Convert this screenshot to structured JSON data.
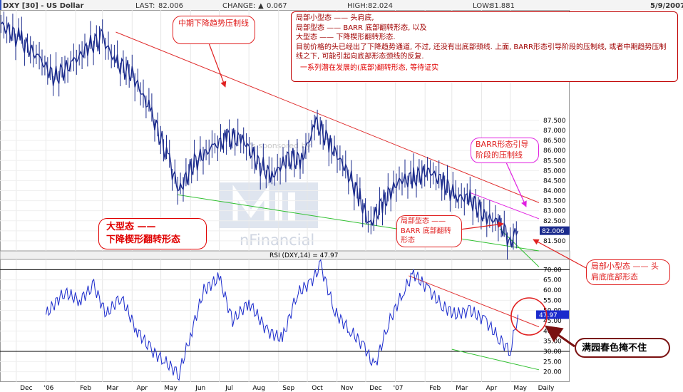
{
  "header": {
    "symbol": "DXY [30] - US Dollar",
    "last_label": "LAST:",
    "last_value": "82.006",
    "change_label": "CHANGE:",
    "change_arrow": "▲",
    "change_value": "0.067",
    "high_label": "HIGH:",
    "high_value": "82.024",
    "low_label": "LOW:",
    "low_value": "81.881",
    "date": "5/9/2007"
  },
  "watermark": {
    "partial_text": "'s sponsored by",
    "brand_fragment": "nFinancial"
  },
  "chart_data": [
    {
      "type": "line",
      "series": [
        {
          "x": [
            "2005-11-15",
            "2005-12-05",
            "2005-12-25",
            "2006-01-10",
            "2006-01-30",
            "2006-02-15",
            "2006-03-01",
            "2006-03-15",
            "2006-04-01",
            "2006-04-20",
            "2006-05-10",
            "2006-05-20",
            "2006-06-05",
            "2006-06-25",
            "2006-07-10",
            "2006-07-25",
            "2006-08-10",
            "2006-08-25",
            "2006-09-10",
            "2006-09-25",
            "2006-10-10",
            "2006-10-25",
            "2006-11-10",
            "2006-11-25",
            "2006-12-05",
            "2006-12-20",
            "2007-01-05",
            "2007-01-20",
            "2007-02-05",
            "2007-02-20",
            "2007-03-05",
            "2007-03-20",
            "2007-04-05",
            "2007-04-20",
            "2007-05-01",
            "2007-05-09"
          ],
          "values": [
            92.3,
            91.5,
            90.6,
            89.6,
            90.4,
            91.2,
            91.6,
            90.4,
            89.8,
            88.0,
            85.4,
            84.0,
            85.4,
            86.2,
            86.6,
            86.6,
            85.4,
            84.7,
            85.6,
            85.5,
            87.4,
            86.3,
            85.1,
            83.6,
            82.3,
            83.5,
            84.5,
            84.6,
            85.0,
            84.4,
            83.7,
            83.6,
            82.7,
            82.4,
            81.5,
            82.0
          ]
        }
      ],
      "y_ticks": [
        "81.500",
        "82.000",
        "82.500",
        "83.000",
        "83.500",
        "84.000",
        "84.500",
        "85.000",
        "85.500",
        "86.000",
        "86.500",
        "87.000",
        "87.500"
      ],
      "y_display_range": [
        81.0,
        93.0
      ],
      "last_value_label": "82.006",
      "trendlines": [
        {
          "name": "mid-term-downtrend",
          "color": "#e03030",
          "from": [
            "2006-03-15",
            91.9
          ],
          "to": [
            "2007-05-31",
            83.4
          ]
        },
        {
          "name": "wedge-support",
          "color": "#30c030",
          "from": [
            "2006-05-18",
            83.8
          ],
          "to": [
            "2007-05-31",
            81.0
          ]
        },
        {
          "name": "local-support",
          "color": "#30c030",
          "from": [
            "2007-04-20",
            82.1
          ],
          "to": [
            "2007-05-31",
            80.2
          ]
        },
        {
          "name": "barr-resistance",
          "color": "#e020e0",
          "from": [
            "2007-03-20",
            83.9
          ],
          "to": [
            "2007-05-31",
            82.6
          ]
        }
      ]
    },
    {
      "type": "line",
      "title": "RSI (DXY,14) = 47.97",
      "series": [
        {
          "x": [
            "2006-01-01",
            "2006-01-20",
            "2006-02-05",
            "2006-02-20",
            "2006-03-05",
            "2006-03-20",
            "2006-04-05",
            "2006-04-20",
            "2006-05-05",
            "2006-05-20",
            "2006-06-01",
            "2006-06-15",
            "2006-07-01",
            "2006-07-15",
            "2006-08-01",
            "2006-08-20",
            "2006-09-05",
            "2006-09-20",
            "2006-10-05",
            "2006-10-15",
            "2006-10-30",
            "2006-11-15",
            "2006-11-30",
            "2006-12-10",
            "2006-12-25",
            "2007-01-10",
            "2007-01-20",
            "2007-02-05",
            "2007-02-20",
            "2007-03-05",
            "2007-03-20",
            "2007-04-05",
            "2007-04-20",
            "2007-05-01",
            "2007-05-09"
          ],
          "values": [
            48,
            59,
            55,
            62,
            48,
            57,
            41,
            31,
            25,
            19,
            38,
            60,
            66,
            45,
            54,
            40,
            36,
            58,
            64,
            72,
            49,
            40,
            32,
            22,
            44,
            60,
            68,
            60,
            52,
            48,
            50,
            45,
            36,
            30,
            47.97
          ]
        }
      ],
      "y_ticks": [
        "20.00",
        "25.00",
        "30.00",
        "35.00",
        "40.00",
        "45.00",
        "50.00",
        "55.00",
        "60.00",
        "65.00",
        "70.00"
      ],
      "y_range": [
        15,
        75
      ],
      "reference_lines": [
        30,
        70
      ],
      "last_value_label": "47.97",
      "trendlines": [
        {
          "name": "rsi-downtrend",
          "color": "#e03030",
          "from": [
            "2007-01-15",
            67
          ],
          "to": [
            "2007-05-31",
            42
          ]
        },
        {
          "name": "rsi-support",
          "color": "#30c030",
          "from": [
            "2007-03-01",
            31
          ],
          "to": [
            "2007-05-31",
            21
          ]
        }
      ]
    }
  ],
  "x_axis_labels": [
    "Dec",
    "'06",
    "Feb",
    "Mar",
    "Apr",
    "May",
    "Jun",
    "Jul",
    "Aug",
    "Sep",
    "Oct",
    "Nov",
    "Dec",
    "'07",
    "Feb",
    "Mar",
    "Apr",
    "May",
    "Daily"
  ],
  "annotations": {
    "top_box_lines": [
      "局部小型态 —— 头肩底,",
      "局部型态 —— BARR 底部翻转形态, 以及",
      "大型态 —— 下降楔形翻转形态.",
      "目前价格的头已经出了下降趋势通道, 不过, 还没有出底部颈线. 上面, BARR形态引导阶段的压制线, 或者中期趋势压制线之下, 可能引起向底部形态颈线的反复.",
      "一系列潜在发展的(底部)翻转形态, 等待证实"
    ],
    "mid_trend": "中期下降趋势压制线",
    "barr_lead": "BARR形态引导阶段的压制线",
    "big_pattern_line1": "大型态 ——",
    "big_pattern_line2": "下降楔形翻转形态",
    "local_pattern": "局部型态 —— BARR 底部翻转形态",
    "local_small": "局部小型态 —— 头肩底底部形态",
    "rsi_note": "满园春色掩不住"
  }
}
